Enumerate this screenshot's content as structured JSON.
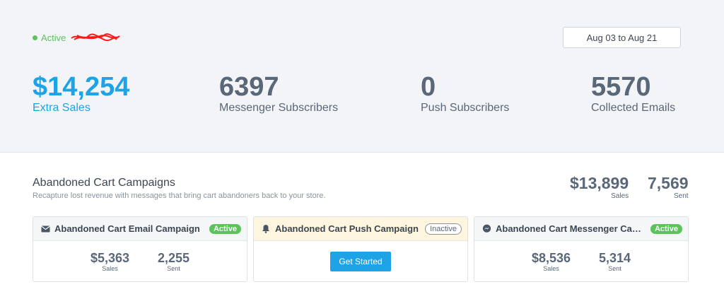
{
  "header": {
    "status": "Active",
    "date_range": "Aug 03 to Aug 21"
  },
  "stats": [
    {
      "value": "$14,254",
      "label": "Extra Sales"
    },
    {
      "value": "6397",
      "label": "Messenger Subscribers"
    },
    {
      "value": "0",
      "label": "Push Subscribers"
    },
    {
      "value": "5570",
      "label": "Collected Emails"
    }
  ],
  "abandoned": {
    "title": "Abandoned Cart Campaigns",
    "subtitle": "Recapture lost revenue with messages that bring cart abandoners back to your store.",
    "sales_value": "$13,899",
    "sales_label": "Sales",
    "sent_value": "7,569",
    "sent_label": "Sent"
  },
  "cards": {
    "email": {
      "title": "Abandoned Cart Email Campaign",
      "badge": "Active",
      "sales": "$5,363",
      "sales_label": "Sales",
      "sent": "2,255",
      "sent_label": "Sent"
    },
    "push": {
      "title": "Abandoned Cart Push Campaign",
      "badge": "Inactive",
      "button": "Get Started"
    },
    "messenger": {
      "title": "Abandoned Cart Messenger Campa...",
      "badge": "Active",
      "sales": "$8,536",
      "sales_label": "Sales",
      "sent": "5,314",
      "sent_label": "Sent"
    }
  },
  "icons": {
    "email": "envelope-icon",
    "push": "bell-icon",
    "messenger": "messenger-icon"
  },
  "colors": {
    "accent": "#1ea3e6",
    "active": "#5cc35a",
    "warn_bg": "#fdf5dd"
  }
}
